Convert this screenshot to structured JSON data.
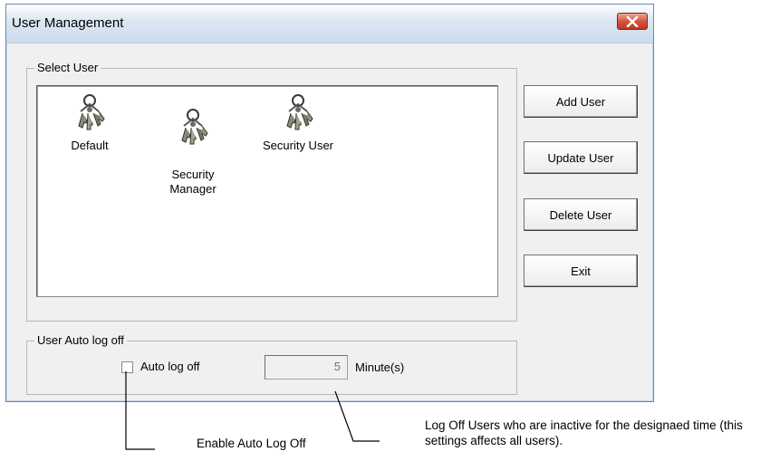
{
  "window": {
    "title": "User Management",
    "close_icon": "close-icon"
  },
  "select_user": {
    "legend": "Select User",
    "users": [
      {
        "label": "Default",
        "icon": "keys-icon"
      },
      {
        "label": "Security\nManager",
        "icon": "keys-icon"
      },
      {
        "label": "Security User",
        "icon": "keys-icon"
      }
    ]
  },
  "buttons": {
    "add": "Add User",
    "update": "Update User",
    "delete": "Delete User",
    "exit": "Exit"
  },
  "auto_logoff": {
    "legend": "User Auto log off",
    "checkbox_label": "Auto log off",
    "checked": false,
    "minutes_value": "5",
    "minutes_unit": "Minute(s)"
  },
  "callouts": {
    "enable": "Enable Auto Log Off",
    "inactive": "Log Off Users who are inactive for the designaed time (this settings affects all users)."
  },
  "colors": {
    "window_bg": "#f0f0f0",
    "close_button": "#d8543f",
    "titlebar": "#dde8f3"
  }
}
